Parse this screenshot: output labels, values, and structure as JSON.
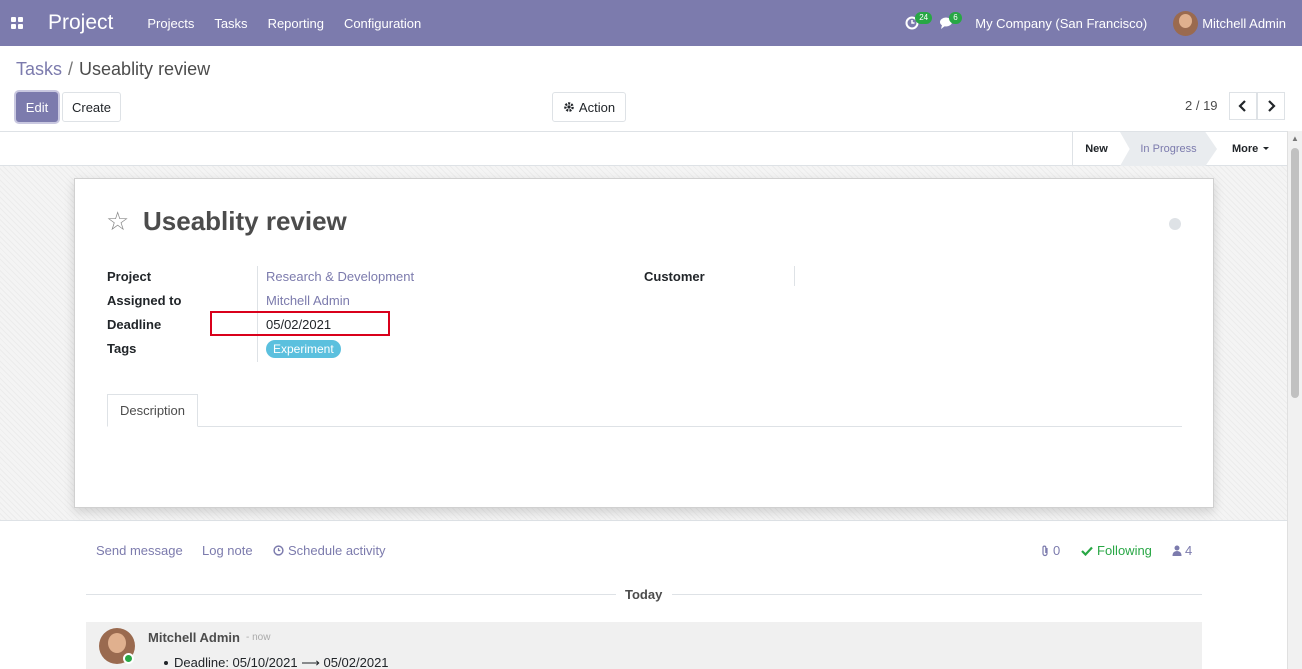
{
  "navbar": {
    "brand": "Project",
    "menu": [
      "Projects",
      "Tasks",
      "Reporting",
      "Configuration"
    ],
    "activity_count": "24",
    "messages_count": "6",
    "company": "My Company (San Francisco)",
    "user": "Mitchell Admin"
  },
  "breadcrumb": {
    "parent": "Tasks",
    "separator": "/",
    "current": "Useablity review"
  },
  "toolbar": {
    "edit_label": "Edit",
    "create_label": "Create",
    "action_label": "Action",
    "pager": "2 / 19"
  },
  "statusbar": {
    "stages": [
      "New",
      "In Progress"
    ],
    "current_stage": "In Progress",
    "more_label": "More"
  },
  "task": {
    "title": "Useablity review",
    "fields": {
      "project_label": "Project",
      "project_value": "Research & Development",
      "assigned_label": "Assigned to",
      "assigned_value": "Mitchell Admin",
      "deadline_label": "Deadline",
      "deadline_value": "05/02/2021",
      "tags_label": "Tags",
      "tag": "Experiment",
      "customer_label": "Customer"
    },
    "tabs": [
      "Description"
    ]
  },
  "chatter": {
    "send_message": "Send message",
    "log_note": "Log note",
    "schedule_activity": "Schedule activity",
    "attachments": "0",
    "following": "Following",
    "followers": "4",
    "today": "Today",
    "message": {
      "author": "Mitchell Admin",
      "time": "- now",
      "change": "Deadline: 05/10/2021 ⟶ 05/02/2021"
    }
  },
  "colors": {
    "brand": "#7c7bad",
    "tag": "#5bc0de",
    "highlight": "#d9001b",
    "following": "#28a745"
  }
}
